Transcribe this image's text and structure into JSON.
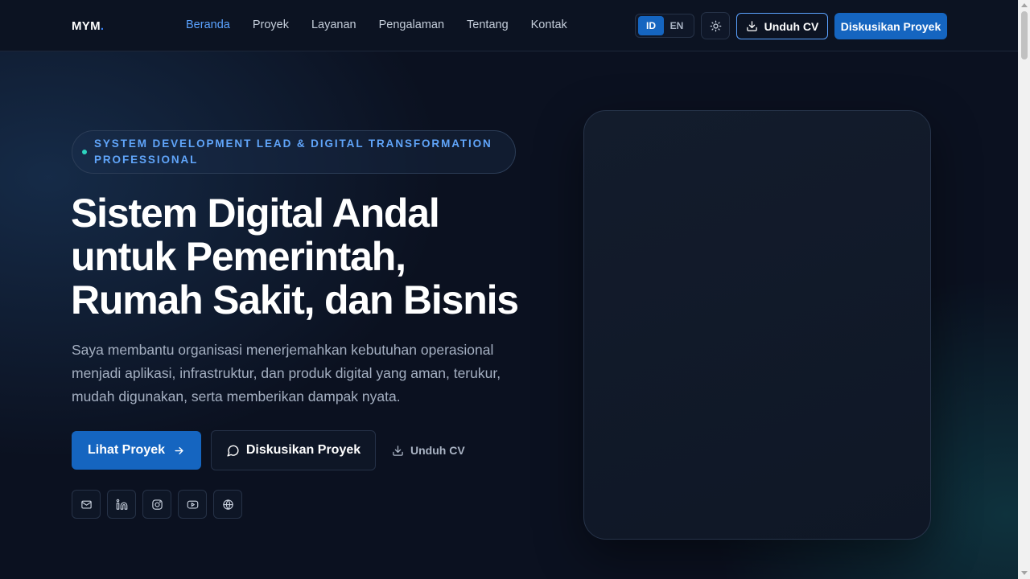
{
  "navbar": {
    "logo": "MYM",
    "logo_dot": ".",
    "links": [
      {
        "label": "Beranda",
        "active": true
      },
      {
        "label": "Proyek"
      },
      {
        "label": "Layanan"
      },
      {
        "label": "Pengalaman"
      },
      {
        "label": "Tentang"
      },
      {
        "label": "Kontak"
      }
    ],
    "lang": {
      "selected": "ID",
      "options": [
        "ID",
        "EN"
      ]
    },
    "theme_icon": "sun-icon",
    "cv_button": "Unduh CV",
    "cta_button": "Diskusikan Proyek"
  },
  "hero": {
    "badge": "SYSTEM DEVELOPMENT LEAD & DIGITAL TRANSFORMATION PROFESSIONAL",
    "title_lines": [
      "Sistem Digital Andal",
      "untuk Pemerintah,",
      "Rumah Sakit, dan Bisnis"
    ],
    "description": "Saya membantu organisasi menerjemahkan kebutuhan operasional menjadi aplikasi, infrastruktur, dan produk digital yang aman, terukur, mudah digunakan, serta memberikan dampak nyata.",
    "primary_button": "Lihat Proyek",
    "secondary_button": "Diskusikan Proyek",
    "link_button": "Unduh CV",
    "socials": [
      "mail-icon",
      "linkedin-icon",
      "instagram-icon",
      "youtube-icon",
      "globe-icon"
    ]
  },
  "colors": {
    "accent": "#1565c0",
    "accent_light": "#5aa2ff",
    "badge_dot": "#2dd4bf",
    "background": "#0b1120"
  }
}
